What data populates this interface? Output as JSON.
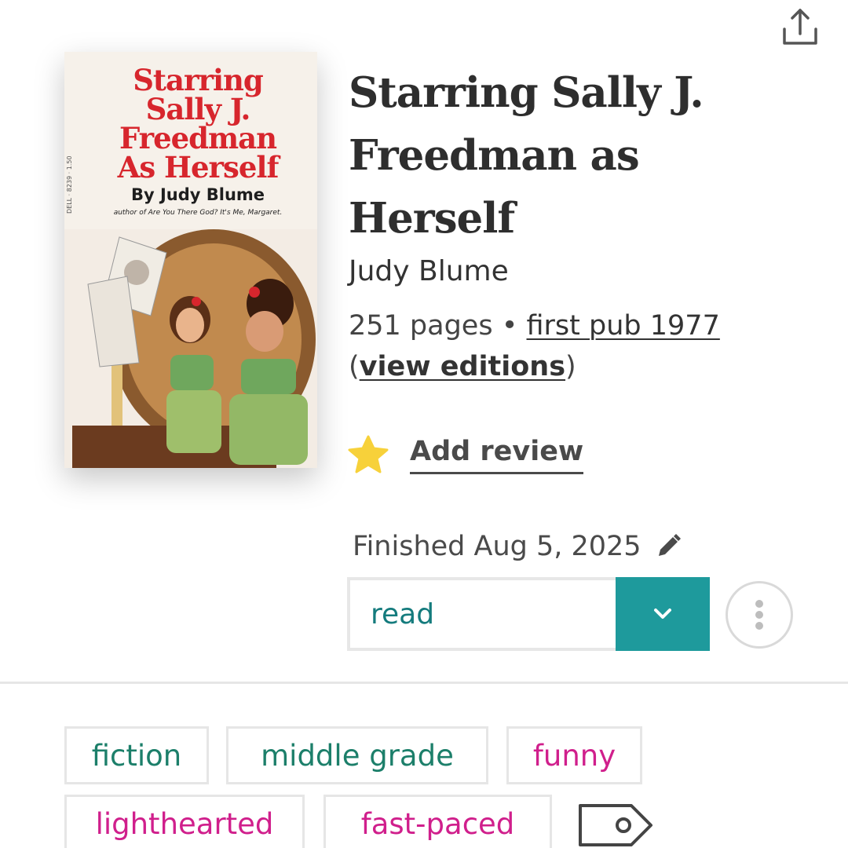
{
  "toolbar": {
    "share_icon": "share-upload-icon"
  },
  "cover": {
    "title_lines": [
      "Starring",
      "Sally J.",
      "Freedman",
      "As Herself"
    ],
    "byline": "By Judy Blume",
    "subline": "author of Are You There God? It's Me, Margaret.",
    "spine": "DELL · 8239 · 1.50"
  },
  "book": {
    "title": "Starring Sally J. Freedman as Herself",
    "author": "Judy Blume",
    "pages": "251 pages",
    "separator": " • ",
    "first_pub": "first pub 1977",
    "paren_open": "(",
    "view_editions": "view editions",
    "paren_close": ")"
  },
  "review": {
    "label": "Add review",
    "icon": "star-icon",
    "star_color": "#f7d13a"
  },
  "status": {
    "finished_label": "Finished Aug 5, 2025",
    "value": "read",
    "accent": "#1e9a9c",
    "text_color": "#147b7d"
  },
  "tags": [
    {
      "label": "fiction",
      "color": "green"
    },
    {
      "label": "middle grade",
      "color": "green"
    },
    {
      "label": "funny",
      "color": "pink"
    },
    {
      "label": "lighthearted",
      "color": "pink"
    },
    {
      "label": "fast-paced",
      "color": "pink"
    }
  ],
  "colors": {
    "tag_green": "#1c7f6a",
    "tag_pink": "#d01f8c"
  }
}
